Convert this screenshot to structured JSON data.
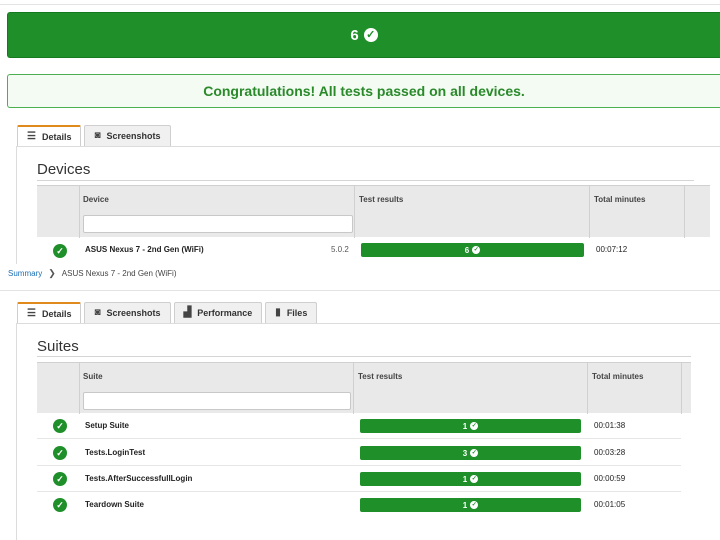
{
  "summary": {
    "passed_count": "6",
    "congrats_message": "Congratulations! All tests passed on all devices."
  },
  "top_tabs": [
    {
      "label": "Details",
      "icon": "list-icon",
      "active": true
    },
    {
      "label": "Screenshots",
      "icon": "camera-icon",
      "active": false
    }
  ],
  "devices": {
    "title": "Devices",
    "columns": {
      "device": "Device",
      "results": "Test results",
      "minutes": "Total minutes"
    },
    "filter_value": "",
    "rows": [
      {
        "status": "passed",
        "name": "ASUS Nexus 7 - 2nd Gen (WiFi)",
        "os": "5.0.2",
        "result": "6",
        "minutes": "00:07:12"
      }
    ]
  },
  "breadcrumb": {
    "root": "Summary",
    "current": "ASUS Nexus 7 - 2nd Gen (WiFi)"
  },
  "device_tabs": [
    {
      "label": "Details",
      "icon": "list-icon",
      "active": true
    },
    {
      "label": "Screenshots",
      "icon": "camera-icon",
      "active": false
    },
    {
      "label": "Performance",
      "icon": "chart-icon",
      "active": false
    },
    {
      "label": "Files",
      "icon": "file-icon",
      "active": false
    }
  ],
  "suites": {
    "title": "Suites",
    "columns": {
      "suite": "Suite",
      "results": "Test results",
      "minutes": "Total minutes"
    },
    "filter_value": "",
    "rows": [
      {
        "status": "passed",
        "name": "Setup Suite",
        "result": "1",
        "minutes": "00:01:38"
      },
      {
        "status": "passed",
        "name": "Tests.LoginTest",
        "result": "3",
        "minutes": "00:03:28"
      },
      {
        "status": "passed",
        "name": "Tests.AfterSuccessfullLogin",
        "result": "1",
        "minutes": "00:00:59"
      },
      {
        "status": "passed",
        "name": "Teardown Suite",
        "result": "1",
        "minutes": "00:01:05"
      }
    ]
  },
  "colors": {
    "pass_green": "#1f8f2a",
    "tab_accent": "#e08a1e",
    "link_blue": "#1a6fb5"
  }
}
